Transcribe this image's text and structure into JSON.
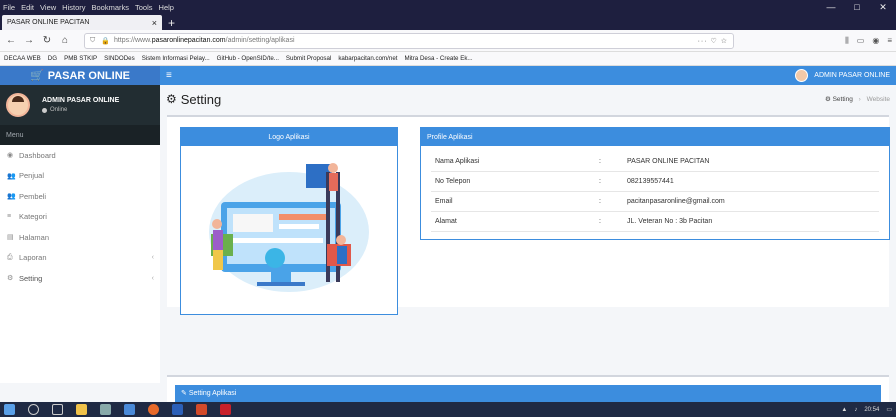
{
  "browser": {
    "menu": [
      "File",
      "Edit",
      "View",
      "History",
      "Bookmarks",
      "Tools",
      "Help"
    ],
    "window_controls": [
      "—",
      "□",
      "✕"
    ],
    "tab_title": "PASAR ONLINE PACITAN",
    "tab_close": "×",
    "new_tab": "+",
    "url_prefix": "https://www.",
    "url_domain": "pasaronlinepacitan.com",
    "url_path": "/admin/setting/aplikasi",
    "url_tail": "··· ♡ ☆",
    "bookmarks": [
      "DECAA WEB",
      "DG",
      "PMB STKIP",
      "SINDODes",
      "Sistem Informasi Pelay...",
      "GitHub - OpenSID/te...",
      "Submit Proposal",
      "kabarpacitan.com/net",
      "Mitra Desa - Create Ek..."
    ]
  },
  "app": {
    "brand": "PASAR ONLINE",
    "user_name": "ADMIN PASAR ONLINE",
    "user_status": "Online",
    "menu_header": "Menu",
    "menu": [
      {
        "icon": "dashboard-icon",
        "glyph": "◉",
        "label": "Dashboard",
        "chevron": ""
      },
      {
        "icon": "users-icon",
        "glyph": "👥",
        "label": "Penjual",
        "chevron": ""
      },
      {
        "icon": "users-icon",
        "glyph": "👥",
        "label": "Pembeli",
        "chevron": ""
      },
      {
        "icon": "list-icon",
        "glyph": "≡",
        "label": "Kategori",
        "chevron": ""
      },
      {
        "icon": "page-icon",
        "glyph": "▤",
        "label": "Halaman",
        "chevron": ""
      },
      {
        "icon": "print-icon",
        "glyph": "⎙",
        "label": "Laporan",
        "chevron": "‹"
      },
      {
        "icon": "gear-icon",
        "glyph": "⚙",
        "label": "Setting",
        "chevron": "‹"
      }
    ]
  },
  "page": {
    "title": "Setting",
    "breadcrumb": [
      "Setting",
      "Website"
    ],
    "logo_card_title": "Logo Aplikasi",
    "profile_card_title": "Profile Aplikasi",
    "profile": [
      {
        "key": "Nama Aplikasi",
        "value": "PASAR ONLINE PACITAN"
      },
      {
        "key": "No Telepon",
        "value": "082139557441"
      },
      {
        "key": "Email",
        "value": "pacitanpasaronline@gmail.com"
      },
      {
        "key": "Alamat",
        "value": "JL. Veteran No : 3b Pacitan"
      }
    ],
    "second_panel_title": "Setting Aplikasi"
  },
  "taskbar": {
    "clock": "20:54"
  },
  "colors": {
    "primary": "#3c8dde",
    "sidebar_dark": "#222d32",
    "taskbar": "#1f2a44"
  }
}
